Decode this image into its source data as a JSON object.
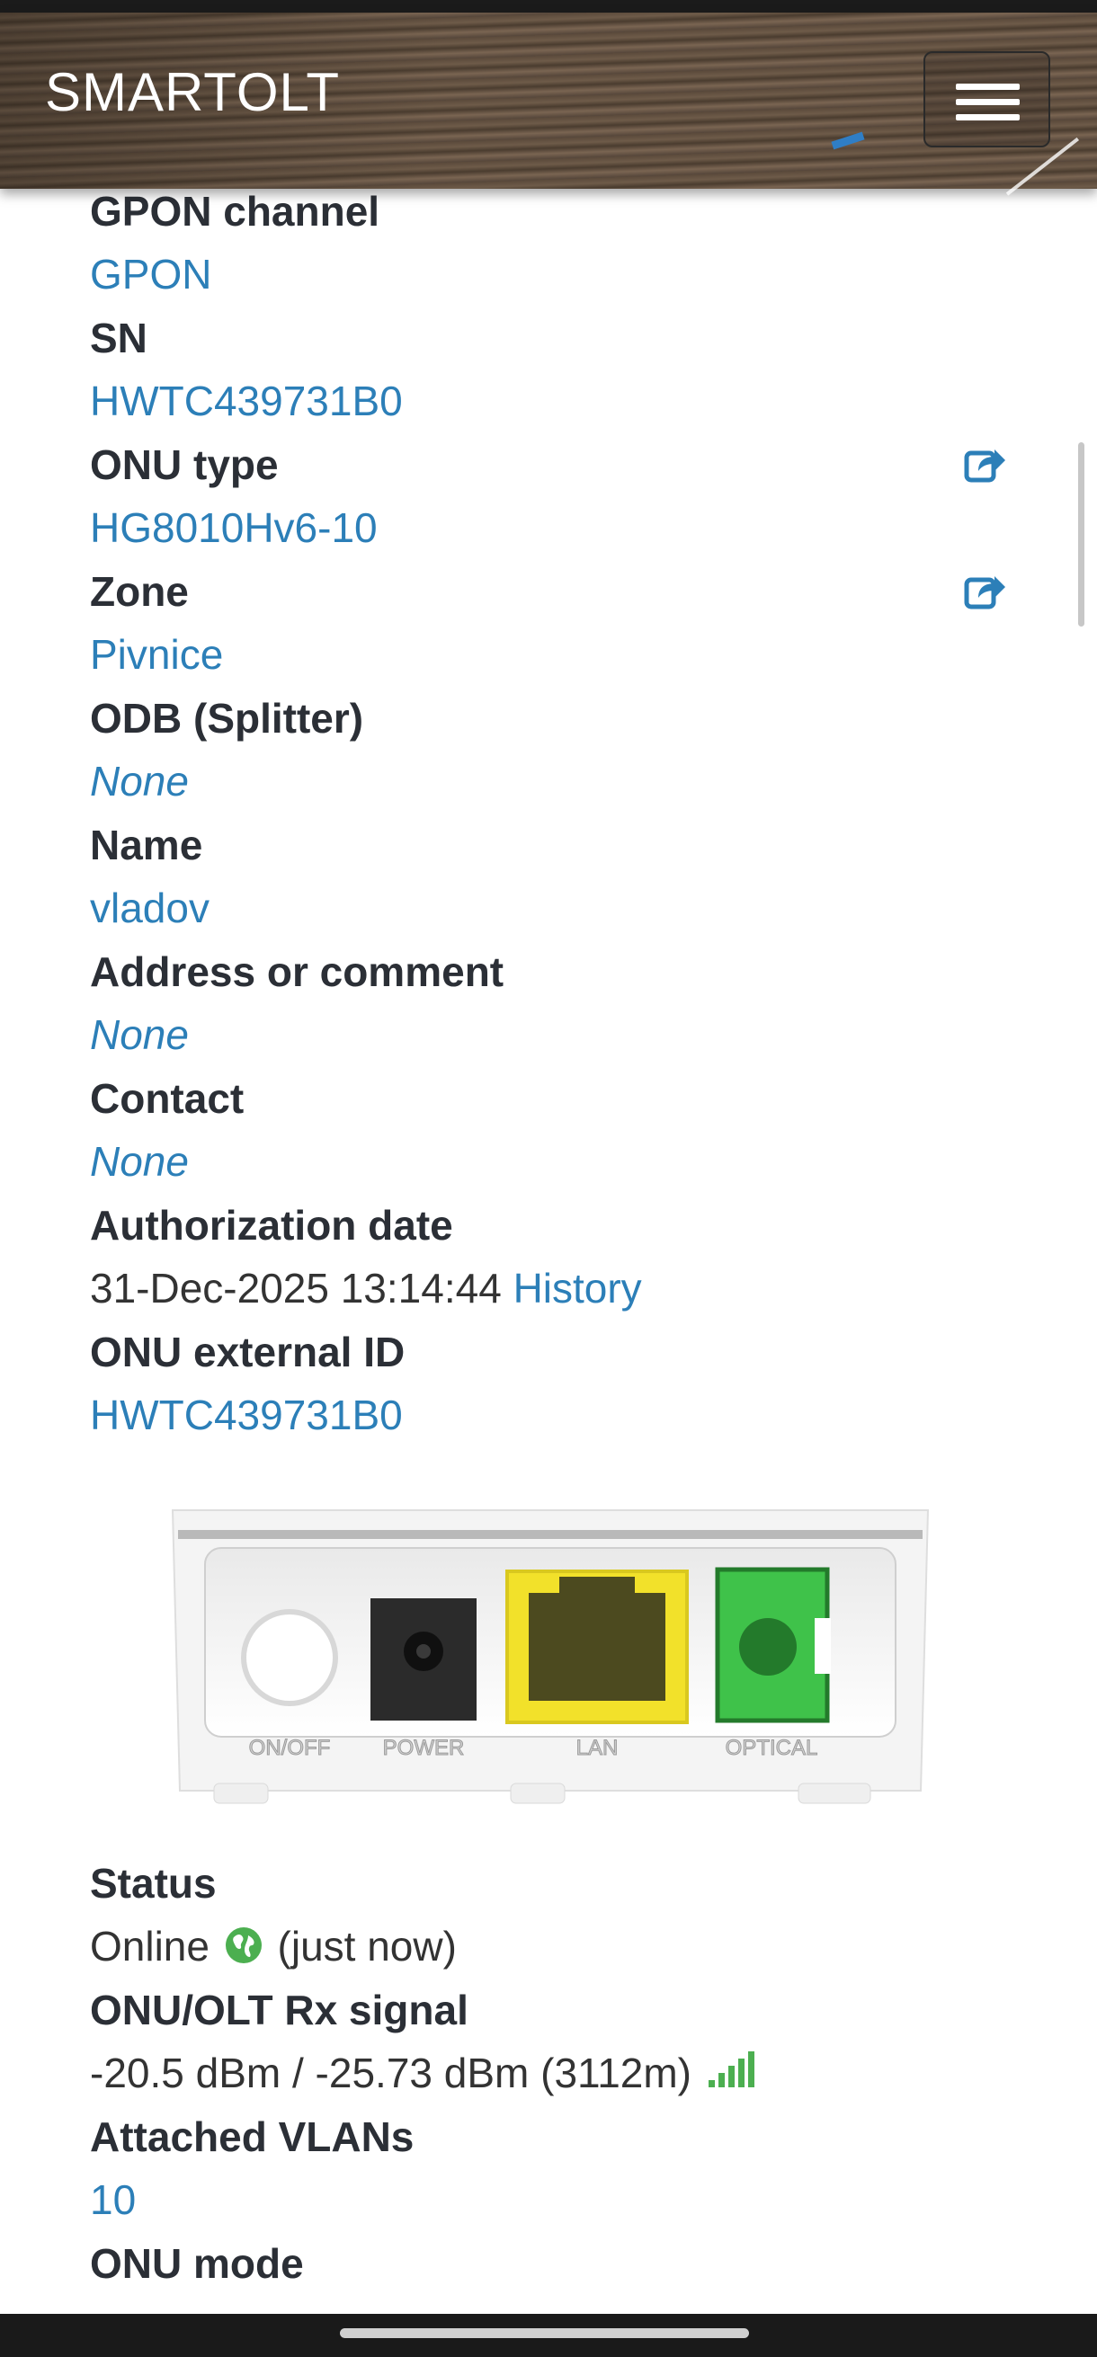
{
  "header": {
    "brand": "SMARTOLT",
    "menu_icon": "hamburger-icon"
  },
  "fields": [
    {
      "label": "GPON channel",
      "value": "GPON",
      "style": "link"
    },
    {
      "label": "SN",
      "value": "HWTC439731B0",
      "style": "link"
    },
    {
      "label": "ONU type",
      "value": "HG8010Hv6-10",
      "style": "link",
      "editable": true
    },
    {
      "label": "Zone",
      "value": "Pivnice",
      "style": "link",
      "editable": true
    },
    {
      "label": "ODB (Splitter)",
      "value": "None",
      "style": "italic"
    },
    {
      "label": "Name",
      "value": "vladov",
      "style": "link"
    },
    {
      "label": "Address or comment",
      "value": "None",
      "style": "italic"
    },
    {
      "label": "Contact",
      "value": "None",
      "style": "italic"
    },
    {
      "label": "Authorization date",
      "value": "31-Dec-2025 13:14:44",
      "link": "History"
    },
    {
      "label": "ONU external ID",
      "value": "HWTC439731B0",
      "style": "link"
    }
  ],
  "device": {
    "ports": [
      "ON/OFF",
      "POWER",
      "LAN",
      "OPTICAL"
    ],
    "colors": {
      "lan": "#f2e12a",
      "optical": "#3fc24a"
    }
  },
  "status": {
    "label": "Status",
    "value": "Online",
    "suffix": "(just now)",
    "online_color": "#4caf50"
  },
  "signal": {
    "label": "ONU/OLT Rx signal",
    "value": "-20.5 dBm / -25.73 dBm (3112m)",
    "bars_color": "#4caf50"
  },
  "vlans": {
    "label": "Attached VLANs",
    "value": "10"
  },
  "mode": {
    "label": "ONU mode"
  },
  "colors": {
    "label": "#2b2f36",
    "link": "#2c7fb8"
  }
}
